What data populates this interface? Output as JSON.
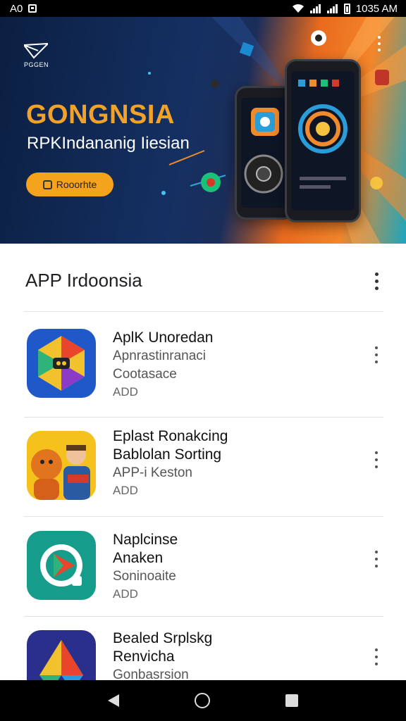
{
  "status_bar": {
    "left_text": "A0",
    "time": "1035 AM"
  },
  "banner": {
    "logo_text": "PGGEN",
    "title": "GONGNSIA",
    "subtitle": "RPKIndananig Iiesian",
    "cta_label": "Rooorhte",
    "colors": {
      "title": "#F2A22B",
      "cta": "#F4A31C",
      "navy": "#143062",
      "orange": "#F3862A"
    }
  },
  "section": {
    "title": "APP Irdoonsia"
  },
  "apps": [
    {
      "name": "AplK Unoredan",
      "line1": "Apnrastinranaci",
      "line2": "Cootasace",
      "badge": "ADD"
    },
    {
      "name": "Eplast Ronakcing",
      "line1": "Bablolan Sorting",
      "line1_is_name": true,
      "line2": "APP-i Keston",
      "badge": "ADD"
    },
    {
      "name": "Naplcinse",
      "line1": "Anaken",
      "line1_is_name": true,
      "line2": "Soninoaite",
      "badge": "ADD"
    },
    {
      "name": "Bealed Srplskg",
      "line1": "Renvicha",
      "line1_is_name": true,
      "line2": "Gonbasrsion",
      "badge": ""
    }
  ]
}
